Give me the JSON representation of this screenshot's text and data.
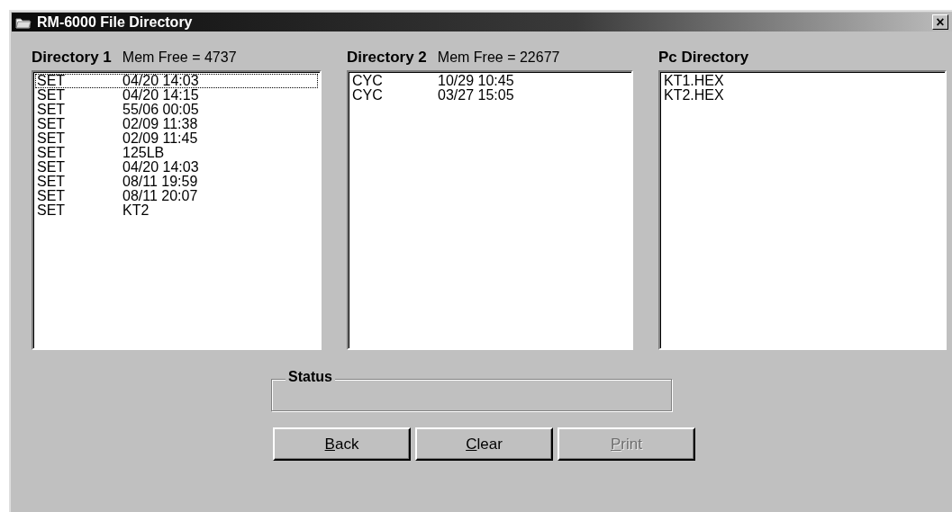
{
  "window": {
    "title": "RM-6000 File Directory",
    "close": "×"
  },
  "directories": [
    {
      "title": "Directory 1",
      "mem_free": "Mem Free = 4737",
      "rows": [
        {
          "type": "SET",
          "info": "04/20 14:03",
          "focused": true
        },
        {
          "type": "SET",
          "info": "04/20 14:15",
          "focused": false
        },
        {
          "type": "SET",
          "info": "55/06 00:05",
          "focused": false
        },
        {
          "type": "SET",
          "info": "02/09 11:38",
          "focused": false
        },
        {
          "type": "SET",
          "info": "02/09 11:45",
          "focused": false
        },
        {
          "type": "SET",
          "info": "125LB",
          "focused": false
        },
        {
          "type": "SET",
          "info": "04/20 14:03",
          "focused": false
        },
        {
          "type": "SET",
          "info": "08/11 19:59",
          "focused": false
        },
        {
          "type": "SET",
          "info": "08/11 20:07",
          "focused": false
        },
        {
          "type": "SET",
          "info": "KT2",
          "focused": false
        }
      ]
    },
    {
      "title": "Directory 2",
      "mem_free": "Mem Free = 22677",
      "rows": [
        {
          "type": "CYC",
          "info": "10/29 10:45",
          "focused": false
        },
        {
          "type": "CYC",
          "info": "03/27 15:05",
          "focused": false
        }
      ]
    },
    {
      "title": "Pc Directory",
      "files": [
        "KT1.HEX",
        "KT2.HEX"
      ]
    }
  ],
  "status": {
    "label": "Status"
  },
  "buttons": [
    {
      "label": "Back",
      "disabled": false
    },
    {
      "label": "Clear",
      "disabled": false
    },
    {
      "label": "Print",
      "disabled": true
    }
  ]
}
